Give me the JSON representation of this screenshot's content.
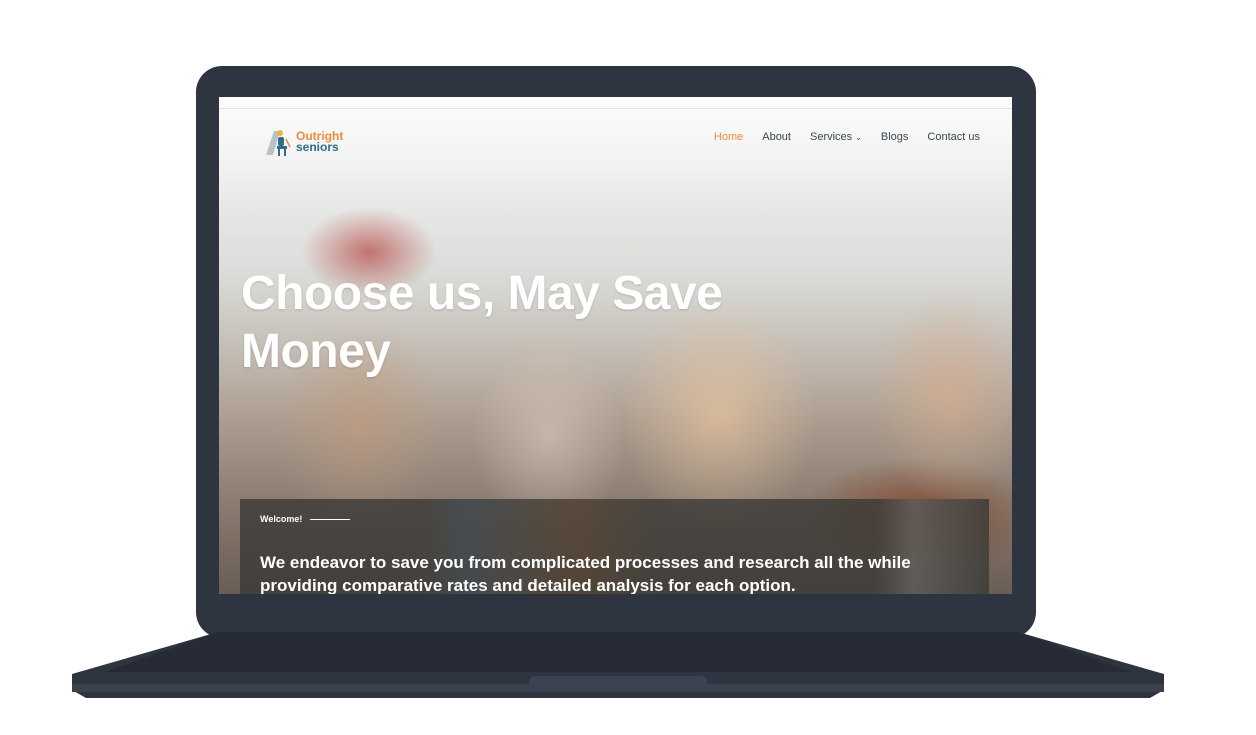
{
  "site": {
    "logo": {
      "line1": "Outright",
      "line2": "seniors"
    },
    "nav": {
      "home": "Home",
      "about": "About",
      "services": "Services",
      "blogs": "Blogs",
      "contact": "Contact us"
    },
    "hero": {
      "title_line1": "Choose us, May Save",
      "title_line2": "Money"
    },
    "panel": {
      "eyebrow": "Welcome!",
      "text": "We endeavor to save you from complicated processes and research all the while providing comparative rates and detailed analysis for each option."
    }
  },
  "colors": {
    "accent": "#f08a3c",
    "brand": "#2f6f86",
    "device": "#2e3440"
  }
}
